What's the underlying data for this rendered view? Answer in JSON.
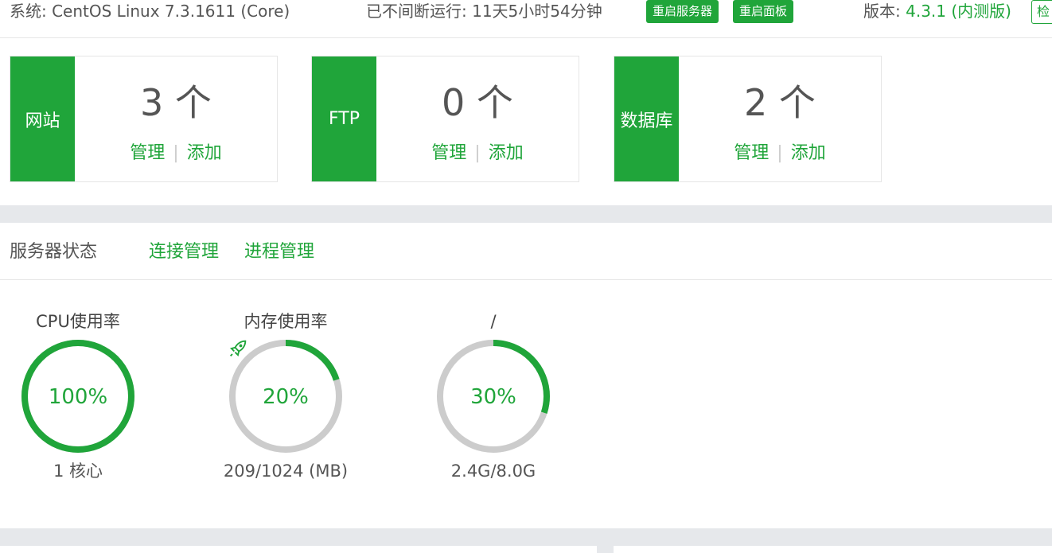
{
  "topbar": {
    "system": "系统: CentOS Linux 7.3.1611 (Core)",
    "uptime": "已不间断运行: 11天5小时54分钟",
    "restart_server": "重启服务器",
    "restart_panel": "重启面板",
    "version_label": "版本: ",
    "version_value": "4.3.1 (内测版)",
    "check_label": "检"
  },
  "cards": [
    {
      "side": "网站",
      "count": "3 个",
      "manage": "管理",
      "add": "添加"
    },
    {
      "side": "FTP",
      "count": "0 个",
      "manage": "管理",
      "add": "添加"
    },
    {
      "side": "数据库",
      "count": "2 个",
      "manage": "管理",
      "add": "添加"
    }
  ],
  "card_separator": "|",
  "server_status": {
    "title": "服务器状态",
    "tabs": [
      "连接管理",
      "进程管理"
    ]
  },
  "gauges": [
    {
      "label": "CPU使用率",
      "percent_text": "100%",
      "percent": 1.0,
      "sub": "1 核心",
      "icon": ""
    },
    {
      "label": "内存使用率",
      "percent_text": "20%",
      "percent": 0.2,
      "sub": "209/1024 (MB)",
      "icon": "rocket-icon"
    },
    {
      "label": "/",
      "percent_text": "30%",
      "percent": 0.3,
      "sub": "2.4G/8.0G",
      "icon": ""
    }
  ],
  "colors": {
    "accent": "#20a53a",
    "track": "#cccccc",
    "band": "#e6e8eb"
  }
}
